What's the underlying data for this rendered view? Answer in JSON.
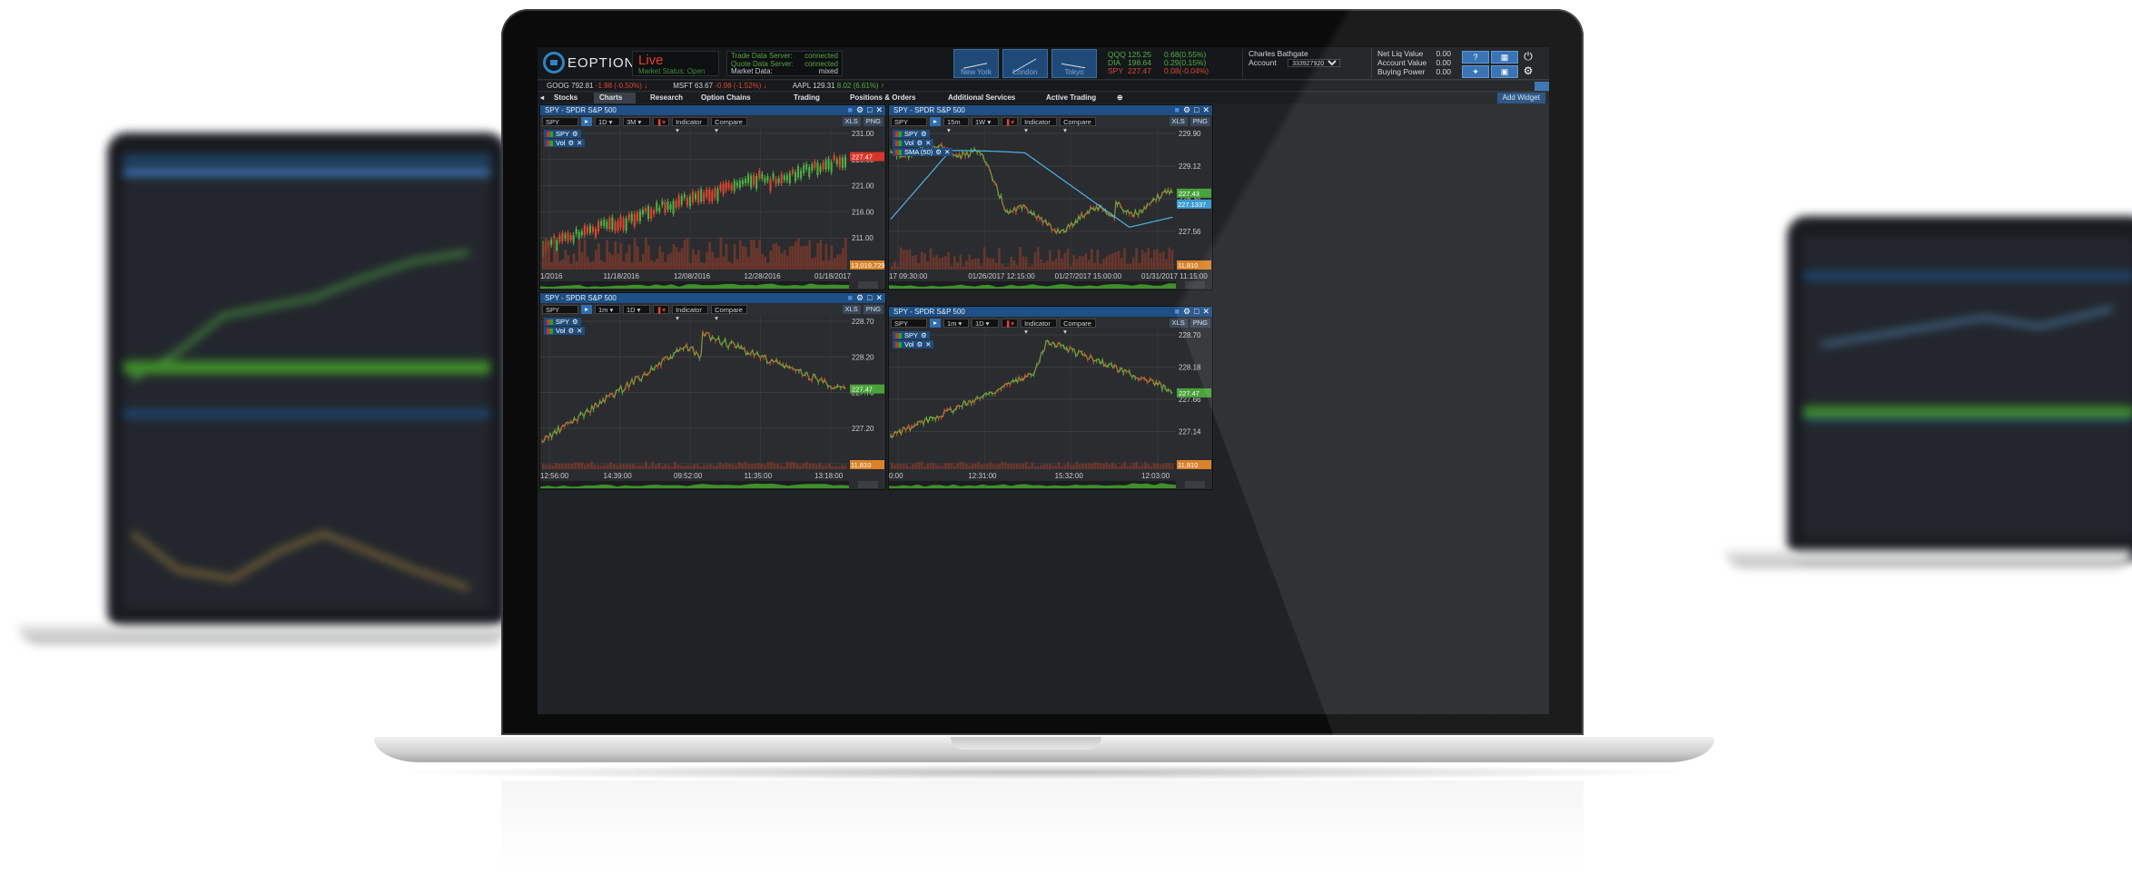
{
  "app": {
    "logo_text": "EOPTION",
    "status_title": "Live",
    "status_sub": "Market Status: Open",
    "servers": [
      {
        "label": "Trade Data Server:",
        "value": "connected"
      },
      {
        "label": "Quote Data Server:",
        "value": "connected"
      },
      {
        "label": "Market Data:",
        "value": "mixed"
      }
    ],
    "clocks": [
      "New York",
      "London",
      "Tokyo"
    ],
    "quotes": [
      {
        "sym": "QQQ",
        "price": "125.25",
        "chg": "0.68(0.55%)",
        "color": "#52b043"
      },
      {
        "sym": "DIA",
        "price": "198.64",
        "chg": "0.29(0.15%)",
        "color": "#52b043"
      },
      {
        "sym": "SPY",
        "price": "227.47",
        "chg": "0.08(-0.04%)",
        "color": "#e0462f"
      }
    ],
    "account_name": "Charles Bathgate",
    "account_label": "Account",
    "account_number": "333927920",
    "liquidity": [
      {
        "label": "Net Liq Value",
        "value": "0.00"
      },
      {
        "label": "Account Value",
        "value": "0.00"
      },
      {
        "label": "Buying Power",
        "value": "0.00"
      }
    ],
    "help_label": "?"
  },
  "ticker": [
    {
      "text": "GOOG 792.81",
      "chg": "-1.98 (-0.50%)",
      "dir": "dn"
    },
    {
      "text": "MSFT 63.67",
      "chg": "-0.98 (-1.52%)",
      "dir": "dn"
    },
    {
      "text": "AAPL 129.31",
      "chg": "8.02 (6.61%)",
      "dir": "up"
    }
  ],
  "tabs": [
    "Stocks",
    "Charts",
    "Research",
    "Option Chains",
    "Trading",
    "Positions & Orders",
    "Additional Services",
    "Active Trading"
  ],
  "active_tab": "Charts",
  "add_widget": "Add Widget",
  "panels": [
    {
      "title": "SPY - SPDR S&P 500",
      "symbol": "SPY",
      "interval": "1D",
      "range": "3M",
      "indicator": "Indicator",
      "compare": "Compare",
      "legend": [
        "SPY",
        "Vol"
      ],
      "yticks": [
        "231.00",
        "226.00",
        "221.00",
        "216.00",
        "211.00",
        "206.00"
      ],
      "xticks": [
        "1/2016",
        "11/18/2016",
        "12/08/2016",
        "12/28/2016",
        "01/18/2017"
      ],
      "price_badge": "227.47",
      "vol_badge": "13,019,729",
      "xls": "XLS",
      "png": "PNG"
    },
    {
      "title": "SPY - SPDR S&P 500",
      "symbol": "SPY",
      "interval": "15m",
      "range": "1W",
      "indicator": "Indicator",
      "compare": "Compare",
      "legend": [
        "SPY",
        "Vol",
        "SMA (50)"
      ],
      "yticks": [
        "229.90",
        "229.12",
        "228.34",
        "227.56",
        "226.78"
      ],
      "xticks": [
        "17 09:30:00",
        "01/26/2017 12:15:00",
        "01/27/2017 15:00:00",
        "01/31/2017 11:15:00"
      ],
      "price_badge": "227.43",
      "sma_badge": "227.1337",
      "vol_badge": "11,810",
      "xls": "XLS",
      "png": "PNG"
    },
    {
      "title": "SPY - SPDR S&P 500",
      "symbol": "SPY",
      "interval": "1m",
      "range": "1D",
      "indicator": "Indicator",
      "compare": "Compare",
      "legend": [
        "SPY",
        "Vol"
      ],
      "yticks": [
        "228.70",
        "228.20",
        "227.70",
        "227.20",
        "226.70"
      ],
      "xticks": [
        "12:56:00",
        "14:39:00",
        "09:52:00",
        "11:35:00",
        "13:18:00"
      ],
      "price_badge": "227.47",
      "vol_badge": "11,810",
      "xls": "XLS",
      "png": "PNG"
    },
    {
      "title": "SPY - SPDR S&P 500",
      "symbol": "SPY",
      "interval": "1m",
      "range": "1D",
      "indicator": "Indicator",
      "compare": "Compare",
      "legend": [
        "SPY",
        "Vol"
      ],
      "yticks": [
        "228.70",
        "228.18",
        "227.66",
        "227.14",
        "226.62"
      ],
      "xticks": [
        "0:00",
        "12:31:00",
        "15:32:00",
        "12:03:00"
      ],
      "price_badge": "227.47",
      "vol_badge": "11,810",
      "xls": "XLS",
      "png": "PNG"
    }
  ],
  "colors": {
    "accent": "#1e4f85",
    "up": "#52b043",
    "down": "#e0462f",
    "sma": "#4fb4e8",
    "volume": "#7a3a2a",
    "volume_strip": "#3f8f2a"
  }
}
